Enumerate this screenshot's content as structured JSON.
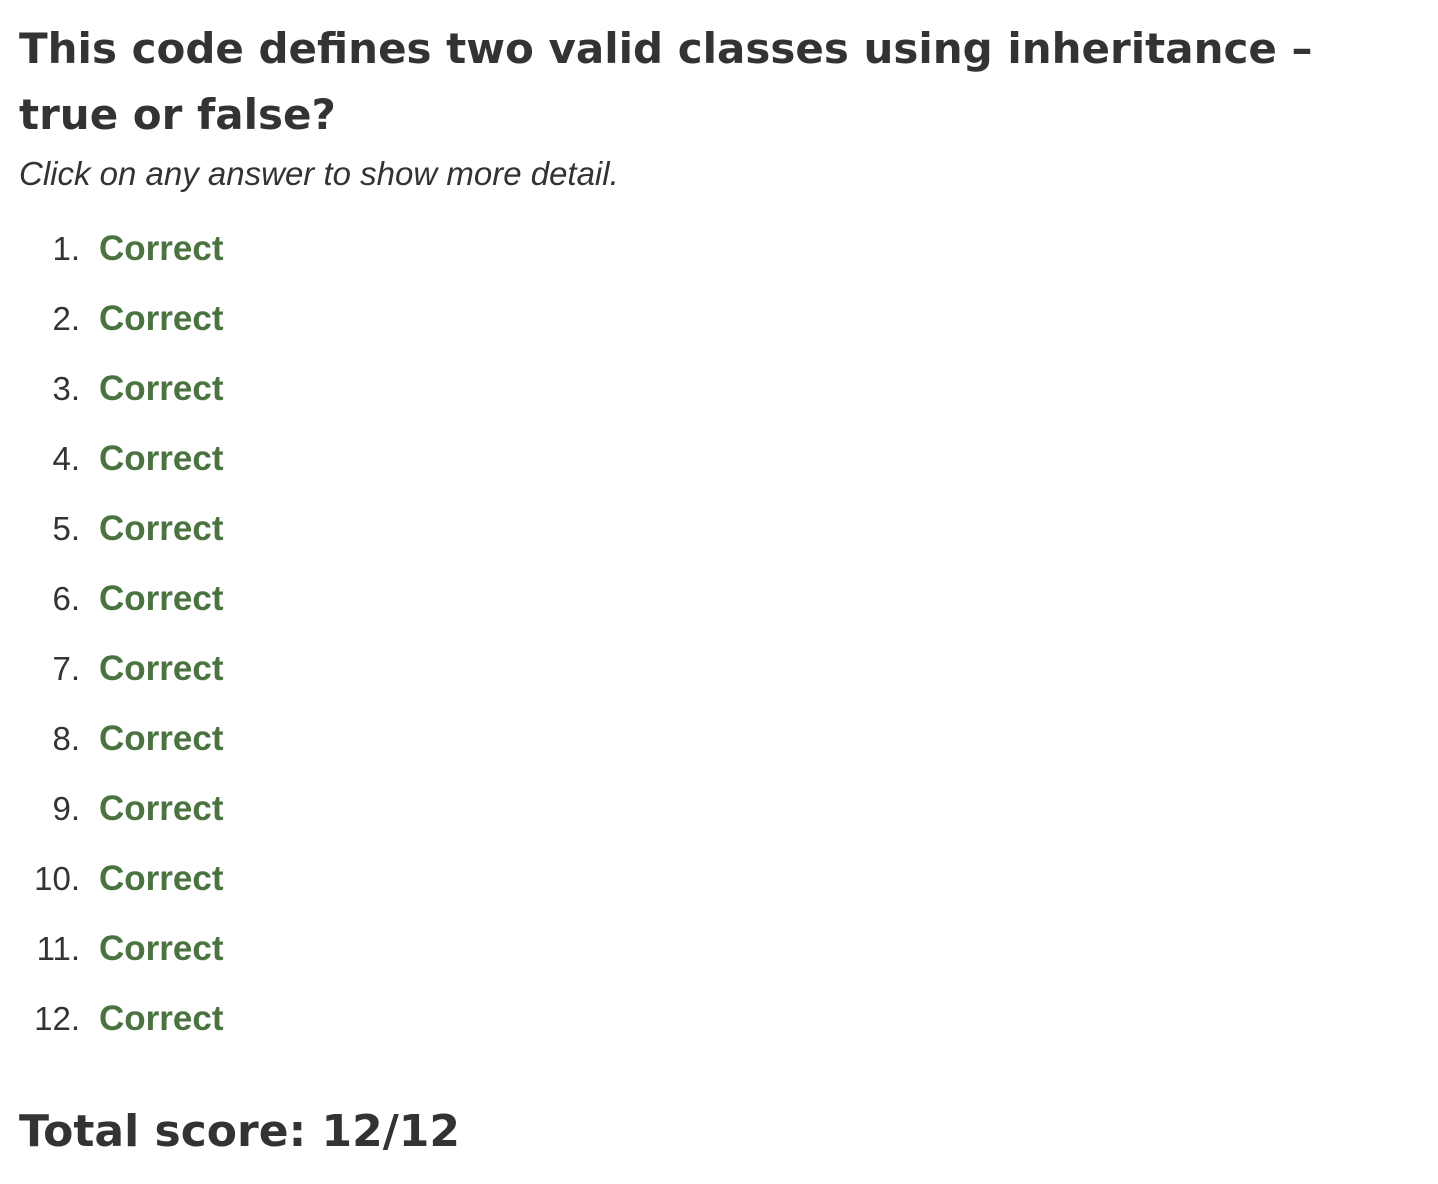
{
  "question": {
    "title": "This code defines two valid classes using inheritance – true or false?",
    "hint": "Click on any answer to show more detail."
  },
  "results": [
    {
      "number": "1.",
      "label": "Correct"
    },
    {
      "number": "2.",
      "label": "Correct"
    },
    {
      "number": "3.",
      "label": "Correct"
    },
    {
      "number": "4.",
      "label": "Correct"
    },
    {
      "number": "5.",
      "label": "Correct"
    },
    {
      "number": "6.",
      "label": "Correct"
    },
    {
      "number": "7.",
      "label": "Correct"
    },
    {
      "number": "8.",
      "label": "Correct"
    },
    {
      "number": "9.",
      "label": "Correct"
    },
    {
      "number": "10.",
      "label": "Correct"
    },
    {
      "number": "11.",
      "label": "Correct"
    },
    {
      "number": "12.",
      "label": "Correct"
    }
  ],
  "score": {
    "text": "Total score: 12/12"
  },
  "colors": {
    "correct": "#4a7340",
    "text": "#333333"
  }
}
